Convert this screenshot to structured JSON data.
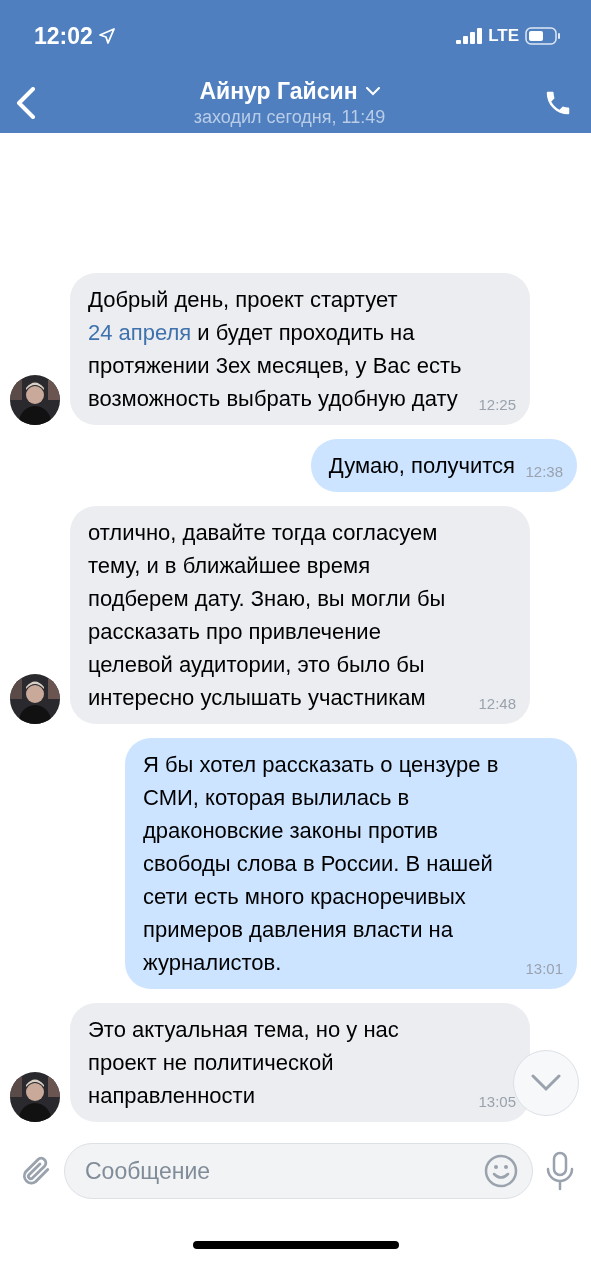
{
  "status_bar": {
    "time": "12:02",
    "network": "LTE"
  },
  "header": {
    "title": "Айнур Гайсин",
    "subtitle": "заходил сегодня, 11:49"
  },
  "messages": [
    {
      "outgoing": false,
      "segments": [
        {
          "kind": "text",
          "text": "Добрый день, проект стартует "
        },
        {
          "kind": "link",
          "text": "24 апреля"
        },
        {
          "kind": "text",
          "text": " и будет проходить на протяжении 3ех месяцев, у Вас есть возможность выбрать удобную дату"
        }
      ],
      "time": "12:25"
    },
    {
      "outgoing": true,
      "segments": [
        {
          "kind": "text",
          "text": "Думаю, получится"
        }
      ],
      "time": "12:38"
    },
    {
      "outgoing": false,
      "segments": [
        {
          "kind": "text",
          "text": "отлично, давайте тогда согласуем тему, и в ближайшее время подберем дату. Знаю, вы могли бы рассказать про привлечение целевой аудитории, это было бы интересно услышать участникам"
        }
      ],
      "time": "12:48"
    },
    {
      "outgoing": true,
      "segments": [
        {
          "kind": "text",
          "text": "Я бы хотел рассказать о цензуре в СМИ, которая вылилась в драконовские законы против свободы слова в России. В нашей сети есть много красноречивых примеров давления власти на журналистов."
        }
      ],
      "time": "13:01"
    },
    {
      "outgoing": false,
      "segments": [
        {
          "kind": "text",
          "text": "Это актуальная тема, но у нас проект не политической направленности"
        }
      ],
      "time": "13:05"
    }
  ],
  "composer": {
    "placeholder": "Сообщение"
  }
}
